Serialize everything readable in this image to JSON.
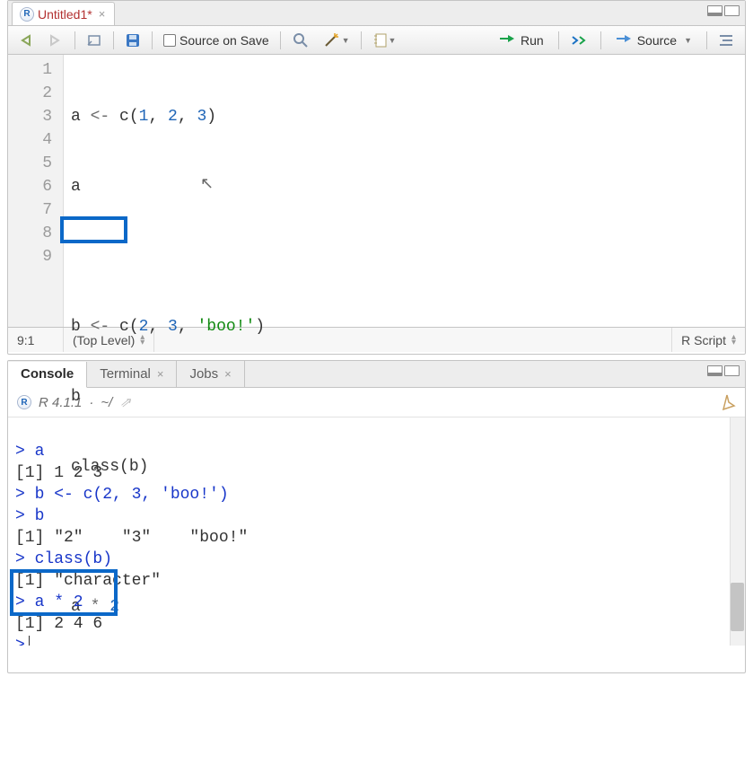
{
  "editor": {
    "tab": {
      "title": "Untitled1*",
      "icon_letter": "R"
    },
    "toolbar": {
      "source_on_save": "Source on Save",
      "run": "Run",
      "source": "Source"
    },
    "lines": [
      {
        "n": "1",
        "raw": "a <- c(1, 2, 3)"
      },
      {
        "n": "2",
        "raw": "a"
      },
      {
        "n": "3",
        "raw": ""
      },
      {
        "n": "4",
        "raw": "b <- c(2, 3, 'boo!')"
      },
      {
        "n": "5",
        "raw": "b"
      },
      {
        "n": "6",
        "raw": "class(b)"
      },
      {
        "n": "7",
        "raw": ""
      },
      {
        "n": "8",
        "raw": "a * 2"
      },
      {
        "n": "9",
        "raw": ""
      }
    ],
    "status": {
      "cursor": "9:1",
      "scope": "(Top Level)",
      "lang": "R Script"
    }
  },
  "console": {
    "tabs": {
      "console": "Console",
      "terminal": "Terminal",
      "jobs": "Jobs"
    },
    "info": {
      "version": "R 4.1.1",
      "path": "~/"
    },
    "lines": [
      {
        "k": "in",
        "t": "> a"
      },
      {
        "k": "out",
        "t": "[1] 1 2 3"
      },
      {
        "k": "in",
        "t": "> b <- c(2, 3, 'boo!')"
      },
      {
        "k": "in",
        "t": "> b"
      },
      {
        "k": "out",
        "t": "[1] \"2\"    \"3\"    \"boo!\""
      },
      {
        "k": "in",
        "t": "> class(b)"
      },
      {
        "k": "out",
        "t": "[1] \"character\""
      },
      {
        "k": "in",
        "t": "> a * 2"
      },
      {
        "k": "out",
        "t": "[1] 2 4 6"
      },
      {
        "k": "in",
        "t": ">"
      }
    ]
  }
}
